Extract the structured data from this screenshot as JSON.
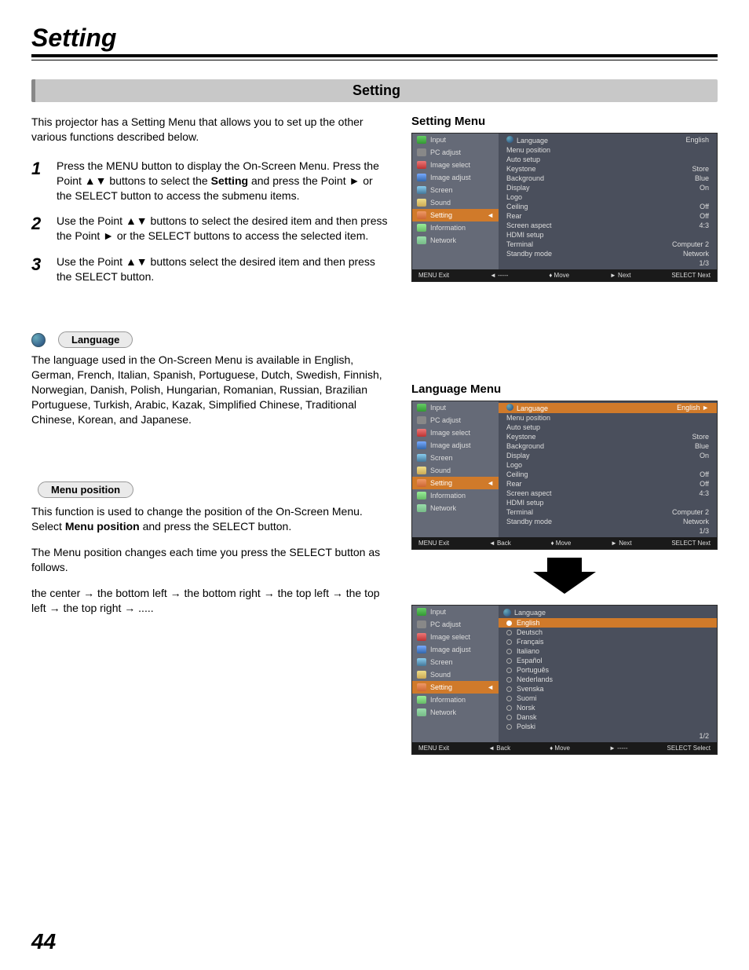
{
  "page": {
    "title": "Setting",
    "section_title": "Setting",
    "number": "44"
  },
  "intro": "This projector has a Setting Menu that allows you to set up the other various functions described below.",
  "steps": [
    {
      "num": "1",
      "text_pre": "Press the MENU button to display the On-Screen Menu. Press the Point ▲▼ buttons to select the ",
      "bold": "Setting",
      "text_post": " and press the Point ► or the SELECT button to access the submenu items."
    },
    {
      "num": "2",
      "text_pre": "Use the Point ▲▼ buttons to select the desired item and then press the Point ► or the SELECT buttons to access the selected item.",
      "bold": "",
      "text_post": ""
    },
    {
      "num": "3",
      "text_pre": "Use the Point ▲▼ buttons select the desired item and then press the SELECT button.",
      "bold": "",
      "text_post": ""
    }
  ],
  "language": {
    "pill": "Language",
    "body": "The language used in the On-Screen Menu is available in English, German, French, Italian, Spanish, Portuguese, Dutch, Swedish, Finnish, Norwegian, Danish, Polish, Hungarian, Romanian, Russian, Brazilian Portuguese, Turkish, Arabic, Kazak, Simplified Chinese, Traditional Chinese, Korean, and Japanese."
  },
  "menu_position": {
    "pill": "Menu position",
    "p1_pre": "This function is used to change the position of the On-Screen Menu. Select ",
    "p1_bold": "Menu position",
    "p1_post": " and press the SELECT button.",
    "p2": "The Menu position changes each time you press the SELECT button as follows.",
    "p3": "the center → the bottom left  → the bottom right  → the top left → the top left  → the top right  → ....."
  },
  "right": {
    "setting_menu_title": "Setting Menu",
    "language_menu_title": "Language Menu"
  },
  "osd1": {
    "side": [
      "Input",
      "PC adjust",
      "Image select",
      "Image adjust",
      "Screen",
      "Sound",
      "Setting",
      "Information",
      "Network"
    ],
    "side_hl_index": 6,
    "header": {
      "label": "Language",
      "value": "English"
    },
    "rows": [
      {
        "l": "Menu position",
        "v": ""
      },
      {
        "l": "Auto setup",
        "v": ""
      },
      {
        "l": "Keystone",
        "v": "Store"
      },
      {
        "l": "Background",
        "v": "Blue"
      },
      {
        "l": "Display",
        "v": "On"
      },
      {
        "l": "Logo",
        "v": ""
      },
      {
        "l": "Ceiling",
        "v": "Off"
      },
      {
        "l": "Rear",
        "v": "Off"
      },
      {
        "l": "Screen aspect",
        "v": "4:3"
      },
      {
        "l": "HDMI setup",
        "v": ""
      },
      {
        "l": "Terminal",
        "v": "Computer 2"
      },
      {
        "l": "Standby mode",
        "v": "Network"
      }
    ],
    "page": "1/3",
    "bar": [
      "MENU Exit",
      "◄ -----",
      "♦ Move",
      "► Next",
      "SELECT Next"
    ]
  },
  "osd2": {
    "side": [
      "Input",
      "PC adjust",
      "Image select",
      "Image adjust",
      "Screen",
      "Sound",
      "Setting",
      "Information",
      "Network"
    ],
    "side_hl_index": 6,
    "header_hl": {
      "label": "Language",
      "value": "English ►"
    },
    "rows": [
      {
        "l": "Menu position",
        "v": ""
      },
      {
        "l": "Auto setup",
        "v": ""
      },
      {
        "l": "Keystone",
        "v": "Store"
      },
      {
        "l": "Background",
        "v": "Blue"
      },
      {
        "l": "Display",
        "v": "On"
      },
      {
        "l": "Logo",
        "v": ""
      },
      {
        "l": "Ceiling",
        "v": "Off"
      },
      {
        "l": "Rear",
        "v": "Off"
      },
      {
        "l": "Screen aspect",
        "v": "4:3"
      },
      {
        "l": "HDMI setup",
        "v": ""
      },
      {
        "l": "Terminal",
        "v": "Computer 2"
      },
      {
        "l": "Standby mode",
        "v": "Network"
      }
    ],
    "page": "1/3",
    "bar": [
      "MENU Exit",
      "◄ Back",
      "♦ Move",
      "► Next",
      "SELECT Next"
    ]
  },
  "osd3": {
    "side": [
      "Input",
      "PC adjust",
      "Image select",
      "Image adjust",
      "Screen",
      "Sound",
      "Setting",
      "Information",
      "Network"
    ],
    "side_hl_index": 6,
    "header": "Language",
    "langs": [
      "English",
      "Deutsch",
      "Français",
      "Italiano",
      "Español",
      "Português",
      "Nederlands",
      "Svenska",
      "Suomi",
      "Norsk",
      "Dansk",
      "Polski"
    ],
    "lang_hl_index": 0,
    "page": "1/2",
    "bar": [
      "MENU Exit",
      "◄ Back",
      "♦ Move",
      "► -----",
      "SELECT Select"
    ]
  }
}
